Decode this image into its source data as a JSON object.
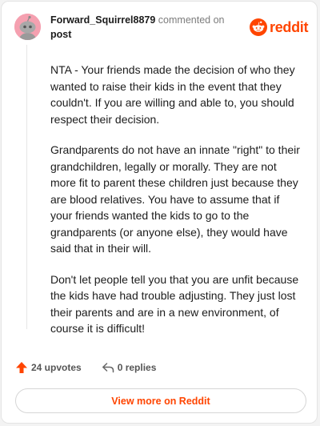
{
  "comment": {
    "username": "Forward_Squirrel8879",
    "action_text": "commented on",
    "target_link": "post",
    "paragraphs": [
      "NTA - Your friends made the decision of who they wanted to raise their kids in the event that they couldn't. If you are willing and able to, you should respect their decision.",
      "Grandparents do not have an innate \"right\" to their grandchildren, legally or morally. They are not more fit to parent these children just because they are blood relatives. You have to assume that if your friends wanted the kids to go to the grandparents (or anyone else), they would have said that in their will.",
      "Don't let people tell you that you are unfit because the kids have had trouble adjusting. They just lost their parents and are in a new environment, of course it is difficult!"
    ]
  },
  "brand": {
    "name": "reddit",
    "icon": "reddit-snoo-icon",
    "color": "#ff4500"
  },
  "footer": {
    "upvotes_label": "24 upvotes",
    "upvote_icon": "upvote-arrow-icon",
    "replies_label": "0 replies",
    "reply_icon": "reply-arrow-icon",
    "view_more_label": "View more on Reddit"
  },
  "colors": {
    "accent": "#ff4500",
    "avatar_bg": "#f5a0b0"
  }
}
